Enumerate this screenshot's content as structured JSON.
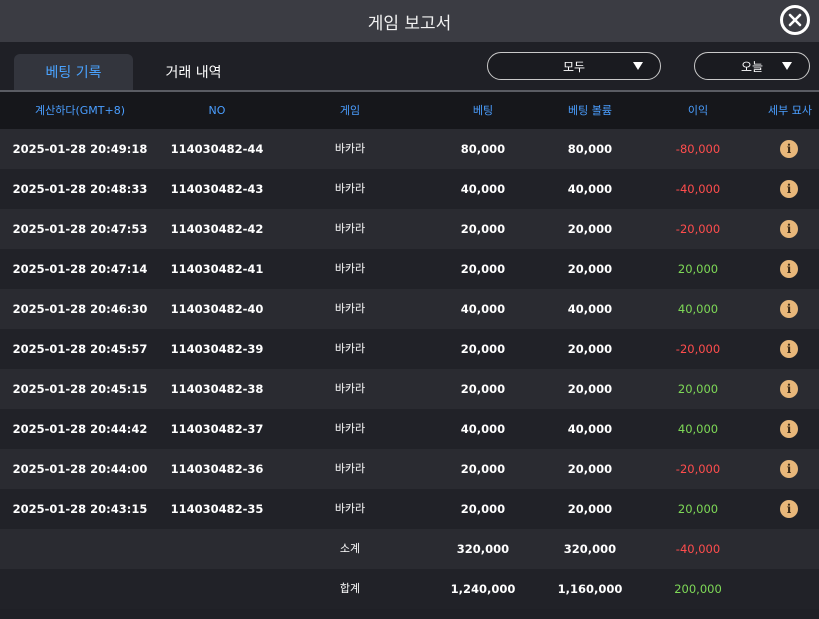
{
  "window": {
    "title": "게임 보고서"
  },
  "tabs": [
    {
      "label": "베팅 기록",
      "active": true
    },
    {
      "label": "거래 내역",
      "active": false
    }
  ],
  "filters": {
    "category": "모두",
    "period": "오늘"
  },
  "table": {
    "headers": {
      "time": "계산하다(GMT+8)",
      "no": "NO",
      "game": "게임",
      "bet": "베팅",
      "volume": "베팅 볼륨",
      "profit": "이익",
      "detail": "세부 묘사"
    },
    "rows": [
      {
        "time": "2025-01-28 20:49:18",
        "no": "114030482-44",
        "game": "바카라",
        "bet": "80,000",
        "volume": "80,000",
        "profit": "-80,000",
        "profit_sign": "neg"
      },
      {
        "time": "2025-01-28 20:48:33",
        "no": "114030482-43",
        "game": "바카라",
        "bet": "40,000",
        "volume": "40,000",
        "profit": "-40,000",
        "profit_sign": "neg"
      },
      {
        "time": "2025-01-28 20:47:53",
        "no": "114030482-42",
        "game": "바카라",
        "bet": "20,000",
        "volume": "20,000",
        "profit": "-20,000",
        "profit_sign": "neg"
      },
      {
        "time": "2025-01-28 20:47:14",
        "no": "114030482-41",
        "game": "바카라",
        "bet": "20,000",
        "volume": "20,000",
        "profit": "20,000",
        "profit_sign": "pos"
      },
      {
        "time": "2025-01-28 20:46:30",
        "no": "114030482-40",
        "game": "바카라",
        "bet": "40,000",
        "volume": "40,000",
        "profit": "40,000",
        "profit_sign": "pos"
      },
      {
        "time": "2025-01-28 20:45:57",
        "no": "114030482-39",
        "game": "바카라",
        "bet": "20,000",
        "volume": "20,000",
        "profit": "-20,000",
        "profit_sign": "neg"
      },
      {
        "time": "2025-01-28 20:45:15",
        "no": "114030482-38",
        "game": "바카라",
        "bet": "20,000",
        "volume": "20,000",
        "profit": "20,000",
        "profit_sign": "pos"
      },
      {
        "time": "2025-01-28 20:44:42",
        "no": "114030482-37",
        "game": "바카라",
        "bet": "40,000",
        "volume": "40,000",
        "profit": "40,000",
        "profit_sign": "pos"
      },
      {
        "time": "2025-01-28 20:44:00",
        "no": "114030482-36",
        "game": "바카라",
        "bet": "20,000",
        "volume": "20,000",
        "profit": "-20,000",
        "profit_sign": "neg"
      },
      {
        "time": "2025-01-28 20:43:15",
        "no": "114030482-35",
        "game": "바카라",
        "bet": "20,000",
        "volume": "20,000",
        "profit": "20,000",
        "profit_sign": "pos"
      }
    ],
    "subtotal": {
      "label": "소계",
      "bet": "320,000",
      "volume": "320,000",
      "profit": "-40,000",
      "profit_sign": "neg"
    },
    "total": {
      "label": "합계",
      "bet": "1,240,000",
      "volume": "1,160,000",
      "profit": "200,000",
      "profit_sign": "pos"
    }
  },
  "icons": {
    "close": "close-icon",
    "detail": "info-icon",
    "dropdown": "caret-down-icon"
  },
  "colors": {
    "accent": "#4a9eff",
    "negative": "#ff4d4d",
    "positive": "#7ed957",
    "info": "#e8b77a"
  }
}
